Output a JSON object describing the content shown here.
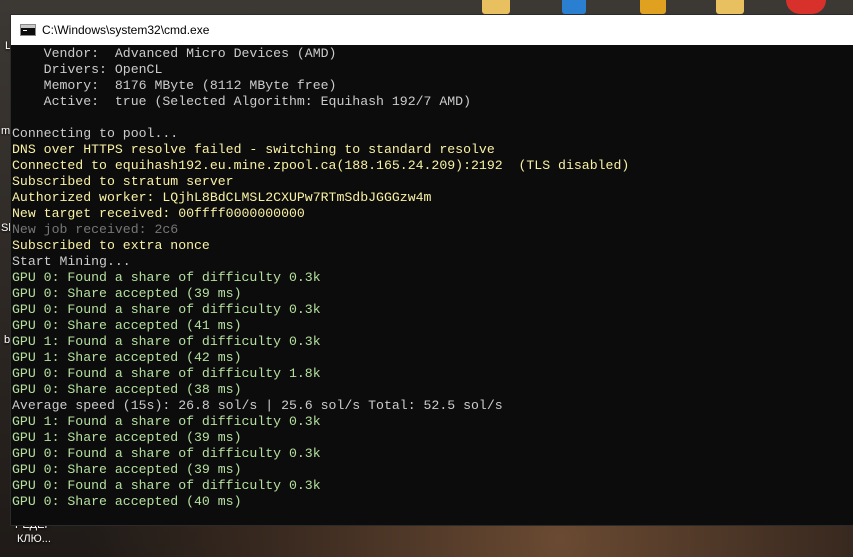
{
  "window": {
    "title": "C:\\Windows\\system32\\cmd.exe"
  },
  "desktop": {
    "labels": [
      "L",
      "m",
      "Sk",
      "b",
      "РЕДЕР",
      "КЛЮ..."
    ]
  },
  "colors": {
    "default": "#cccccc",
    "yellow": "#f9f1a5",
    "green": "#b5e0a0",
    "gray": "#767676"
  },
  "console": {
    "lines": [
      {
        "text": "    Vendor:  Advanced Micro Devices (AMD)",
        "color": "default"
      },
      {
        "text": "    Drivers: OpenCL",
        "color": "default"
      },
      {
        "text": "    Memory:  8176 MByte (8112 MByte free)",
        "color": "default"
      },
      {
        "text": "    Active:  true (Selected Algorithm: Equihash 192/7 AMD)",
        "color": "default"
      },
      {
        "text": "",
        "color": "default"
      },
      {
        "text": "Connecting to pool...",
        "color": "default"
      },
      {
        "text": "DNS over HTTPS resolve failed - switching to standard resolve",
        "color": "yellow"
      },
      {
        "text": "Connected to equihash192.eu.mine.zpool.ca(188.165.24.209):2192  (TLS disabled)",
        "color": "yellow"
      },
      {
        "text": "Subscribed to stratum server",
        "color": "yellow"
      },
      {
        "text": "Authorized worker: LQjhL8BdCLMSL2CXUPw7RTmSdbJGGGzw4m",
        "color": "yellow"
      },
      {
        "text": "New target received: 00ffff0000000000",
        "color": "yellow"
      },
      {
        "text": "New job received: 2c6",
        "color": "gray"
      },
      {
        "text": "Subscribed to extra nonce",
        "color": "yellow"
      },
      {
        "text": "Start Mining...",
        "color": "default"
      },
      {
        "text": "GPU 0: Found a share of difficulty 0.3k",
        "color": "green"
      },
      {
        "text": "GPU 0: Share accepted (39 ms)",
        "color": "green"
      },
      {
        "text": "GPU 0: Found a share of difficulty 0.3k",
        "color": "green"
      },
      {
        "text": "GPU 0: Share accepted (41 ms)",
        "color": "green"
      },
      {
        "text": "GPU 1: Found a share of difficulty 0.3k",
        "color": "green"
      },
      {
        "text": "GPU 1: Share accepted (42 ms)",
        "color": "green"
      },
      {
        "text": "GPU 0: Found a share of difficulty 1.8k",
        "color": "green"
      },
      {
        "text": "GPU 0: Share accepted (38 ms)",
        "color": "green"
      },
      {
        "text": "Average speed (15s): 26.8 sol/s | 25.6 sol/s Total: 52.5 sol/s",
        "color": "default"
      },
      {
        "text": "GPU 1: Found a share of difficulty 0.3k",
        "color": "green"
      },
      {
        "text": "GPU 1: Share accepted (39 ms)",
        "color": "green"
      },
      {
        "text": "GPU 0: Found a share of difficulty 0.3k",
        "color": "green"
      },
      {
        "text": "GPU 0: Share accepted (39 ms)",
        "color": "green"
      },
      {
        "text": "GPU 0: Found a share of difficulty 0.3k",
        "color": "green"
      },
      {
        "text": "GPU 0: Share accepted (40 ms)",
        "color": "green"
      }
    ]
  }
}
